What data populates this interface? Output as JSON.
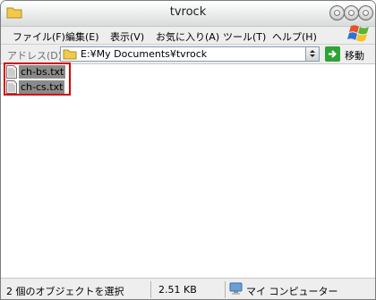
{
  "window": {
    "title": "tvrock"
  },
  "menubar": {
    "items": [
      {
        "label": "ファイル(F)"
      },
      {
        "label": "編集(E)"
      },
      {
        "label": "表示(V)"
      },
      {
        "label": "お気に入り(A)"
      },
      {
        "label": "ツール(T)"
      },
      {
        "label": "ヘルプ(H)"
      }
    ]
  },
  "addressbar": {
    "label": "アドレス(D)",
    "path": "E:¥My Documents¥tvrock",
    "go_label": "移動"
  },
  "files": [
    {
      "name": "ch-bs.txt",
      "icon": "text-file-icon",
      "selected": true
    },
    {
      "name": "ch-cs.txt",
      "icon": "text-file-icon",
      "selected": true
    }
  ],
  "statusbar": {
    "selection_text": "2 個のオブジェクトを選択",
    "size_text": "2.51 KB",
    "location_text": "マイ コンピューター"
  },
  "colors": {
    "selection_highlight": "#8a8a8a",
    "annotation_box": "#d40000",
    "go_button": "#2fa336"
  }
}
